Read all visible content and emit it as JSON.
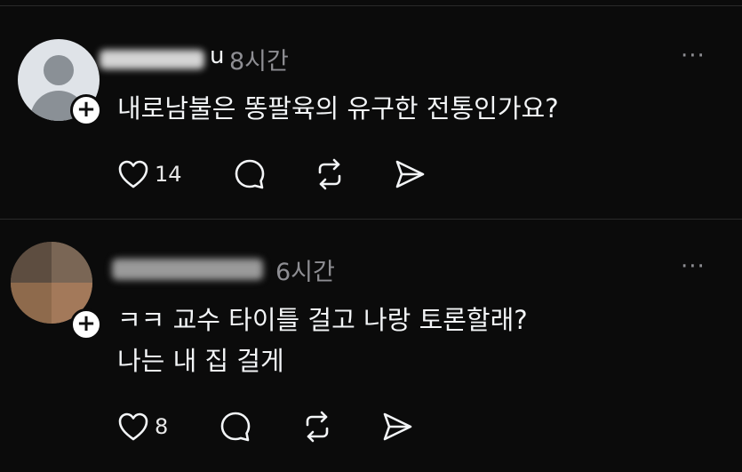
{
  "posts": [
    {
      "username_hidden": "u",
      "time": "8시간",
      "lines": [
        "내로남불은 똥팔육의 유구한 전통인가요?"
      ],
      "likes": "14",
      "more": "···"
    },
    {
      "time": "6시간",
      "lines": [
        "ㅋㅋ 교수 타이틀 걸고 나랑 토론할래?",
        "나는 내 집 걸게"
      ],
      "likes": "8",
      "more": "···"
    }
  ],
  "icons": {
    "like": "heart-icon",
    "comment": "comment-icon",
    "repost": "repost-icon",
    "share": "send-icon",
    "follow": "plus-icon",
    "more": "more-icon"
  },
  "colors": {
    "background": "#0b0b0b",
    "text": "#f3f5f7",
    "muted": "#8e8e93",
    "divider": "#2a2a2a"
  }
}
